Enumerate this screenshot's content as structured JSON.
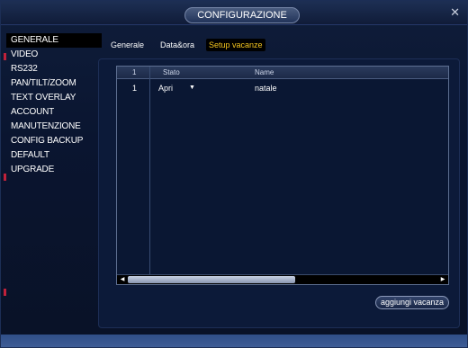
{
  "window": {
    "title": "CONFIGURAZIONE",
    "close_glyph": "✕"
  },
  "sidebar": {
    "items": [
      {
        "label": "GENERALE",
        "active": true
      },
      {
        "label": "VIDEO"
      },
      {
        "label": "RS232"
      },
      {
        "label": "PAN/TILT/ZOOM"
      },
      {
        "label": "TEXT OVERLAY"
      },
      {
        "label": "ACCOUNT"
      },
      {
        "label": "MANUTENZIONE"
      },
      {
        "label": "CONFIG BACKUP"
      },
      {
        "label": "DEFAULT"
      },
      {
        "label": "UPGRADE"
      }
    ]
  },
  "tabs": [
    {
      "label": "Generale"
    },
    {
      "label": "Data&ora"
    },
    {
      "label": "Setup vacanze",
      "active": true
    }
  ],
  "table": {
    "headers": {
      "num": "1",
      "stato": "Stato",
      "name": "Name"
    },
    "rows": [
      {
        "num": "1",
        "stato": "Apri",
        "name": "natale"
      }
    ]
  },
  "add_button": "aggiungi vacanza",
  "colors": {
    "active_tab_text": "#f4c51f",
    "background": "#0a1530",
    "bottom_bar": "#3f5d96"
  },
  "icons": {
    "close": "close-icon",
    "dropdown": "chevron-down-icon",
    "scroll_left": "arrow-left-icon",
    "scroll_right": "arrow-right-icon"
  }
}
